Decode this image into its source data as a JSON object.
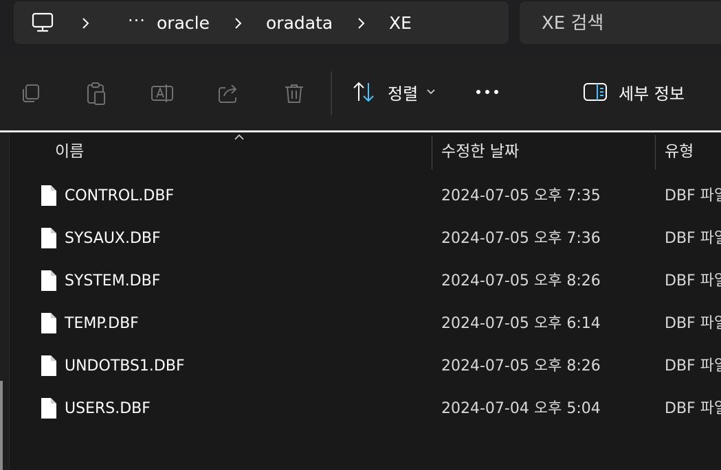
{
  "breadcrumb": {
    "root_icon": "this-pc-icon",
    "ellipsis": "···",
    "items": [
      "oracle",
      "oradata",
      "XE"
    ]
  },
  "search": {
    "placeholder": "XE 검색"
  },
  "toolbar": {
    "icons": [
      "copy-icon",
      "paste-icon",
      "rename-icon",
      "share-icon",
      "delete-icon"
    ],
    "sort_label": "정렬",
    "more_label": "•••",
    "details_label": "세부 정보"
  },
  "columns": {
    "name": "이름",
    "modified": "수정한 날짜",
    "type": "유형"
  },
  "files": [
    {
      "name": "CONTROL.DBF",
      "modified": "2024-07-05 오후 7:35",
      "type": "DBF 파일"
    },
    {
      "name": "SYSAUX.DBF",
      "modified": "2024-07-05 오후 7:36",
      "type": "DBF 파일"
    },
    {
      "name": "SYSTEM.DBF",
      "modified": "2024-07-05 오후 8:26",
      "type": "DBF 파일"
    },
    {
      "name": "TEMP.DBF",
      "modified": "2024-07-05 오후 6:14",
      "type": "DBF 파일"
    },
    {
      "name": "UNDOTBS1.DBF",
      "modified": "2024-07-05 오후 8:26",
      "type": "DBF 파일"
    },
    {
      "name": "USERS.DBF",
      "modified": "2024-07-04 오후 5:04",
      "type": "DBF 파일"
    }
  ],
  "colors": {
    "background": "#191919",
    "toolbar": "#202020",
    "accent": "#4cc2ff"
  }
}
